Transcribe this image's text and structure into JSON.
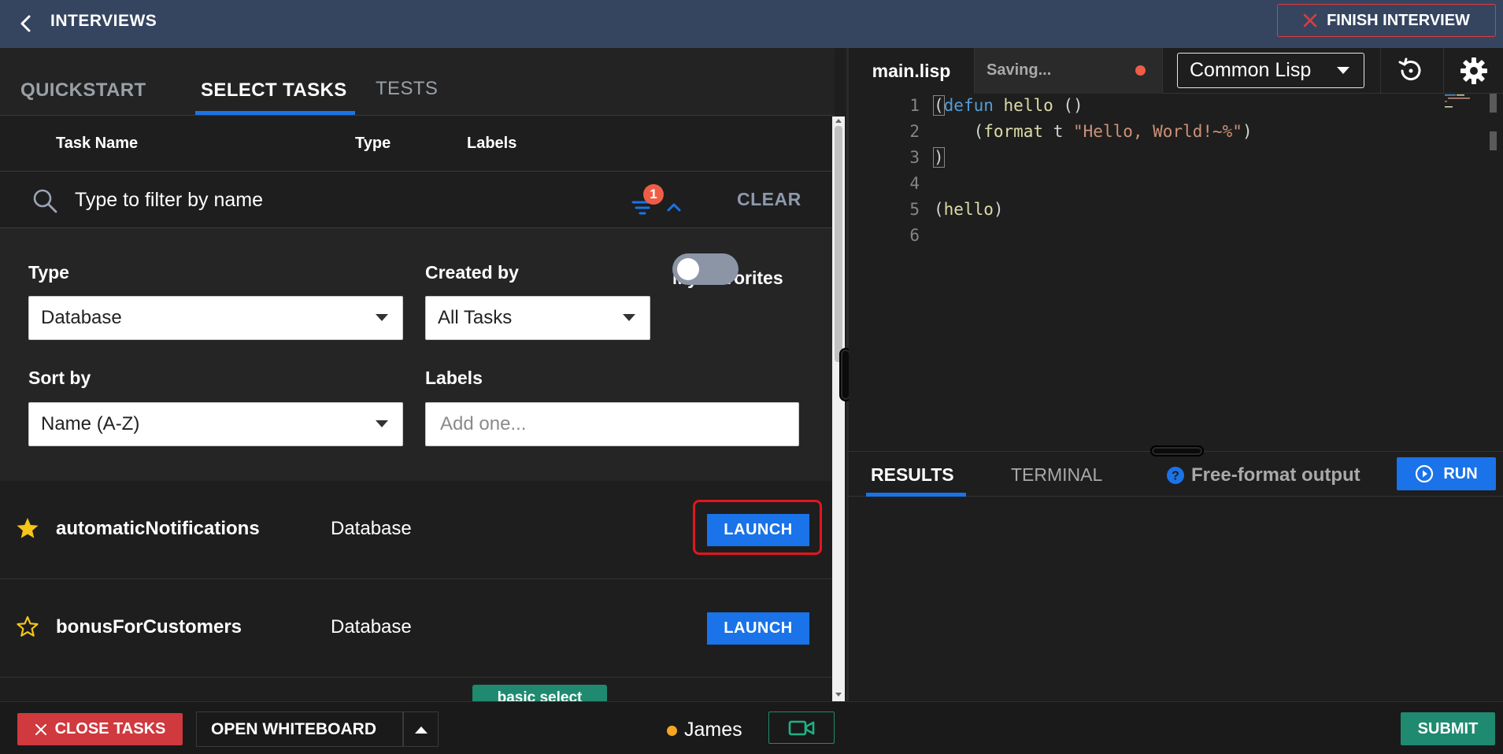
{
  "header": {
    "title": "INTERVIEWS",
    "finish_label": "FINISH INTERVIEW"
  },
  "left_tabs": [
    {
      "label": "QUICKSTART"
    },
    {
      "label": "SELECT TASKS"
    },
    {
      "label": "TESTS"
    }
  ],
  "columns": {
    "task_name": "Task Name",
    "type": "Type",
    "labels": "Labels"
  },
  "filter": {
    "placeholder": "Type to filter by name",
    "badge_count": "1",
    "clear_label": "CLEAR"
  },
  "filters": {
    "type_label": "Type",
    "type_value": "Database",
    "created_by_label": "Created by",
    "created_by_value": "All Tasks",
    "favorites_label": "My Favorites",
    "favorites_on": false,
    "sort_label": "Sort by",
    "sort_value": "Name (A-Z)",
    "labels_label": "Labels",
    "labels_placeholder": "Add one..."
  },
  "tasks": [
    {
      "name": "automaticNotifications",
      "type": "Database",
      "favorite": true,
      "launch": "LAUNCH"
    },
    {
      "name": "bonusForCustomers",
      "type": "Database",
      "favorite": false,
      "launch": "LAUNCH"
    }
  ],
  "partial_tag": "basic select",
  "editor": {
    "filename": "main.lisp",
    "status": "Saving...",
    "language": "Common Lisp",
    "line_numbers": [
      "1",
      "2",
      "3",
      "4",
      "5",
      "6"
    ]
  },
  "results": {
    "tab_results": "RESULTS",
    "tab_terminal": "TERMINAL",
    "free_format": "Free-format output",
    "run_label": "RUN"
  },
  "bottom": {
    "close_tasks": "CLOSE TASKS",
    "open_whiteboard": "OPEN WHITEBOARD",
    "user_name": "James",
    "submit": "SUBMIT"
  },
  "colors": {
    "header_bg": "#354560",
    "accent_blue": "#1a73e8",
    "danger_red": "#d0393e",
    "success_green": "#1f8a70",
    "star_yellow": "#f5c518"
  },
  "icons": [
    "chevron-left-icon",
    "close-icon",
    "history-icon",
    "gear-icon",
    "search-icon",
    "filter-icon",
    "chevron-up-icon",
    "star-icon",
    "help-icon",
    "play-icon",
    "video-camera-icon"
  ]
}
